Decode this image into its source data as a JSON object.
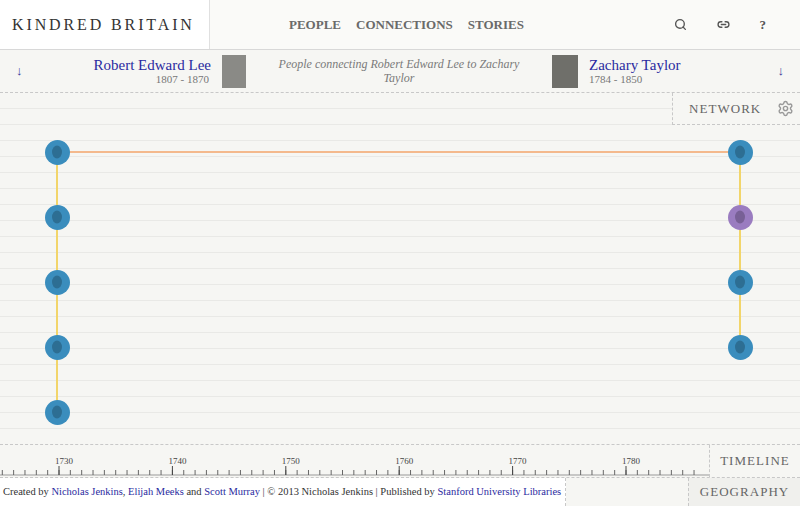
{
  "header": {
    "logo": "KINDRED BRITAIN",
    "nav": [
      "PEOPLE",
      "CONNECTIONS",
      "STORIES"
    ],
    "help": "?"
  },
  "connection": {
    "left": {
      "name": "Robert Edward Lee",
      "dates": "1807 - 1870",
      "arrow": "↓"
    },
    "right": {
      "name": "Zachary Taylor",
      "dates": "1784 - 1850",
      "arrow": "↓"
    },
    "caption": "People connecting Robert Edward Lee to Zachary Taylor"
  },
  "network": {
    "tab": "NETWORK",
    "left_chain": [
      {
        "color": "#3a8dbd"
      },
      {
        "color": "#3a8dbd"
      },
      {
        "color": "#3a8dbd"
      },
      {
        "color": "#3a8dbd"
      },
      {
        "color": "#3a8dbd"
      }
    ],
    "right_chain": [
      {
        "color": "#3a8dbd"
      },
      {
        "color": "#9a7cc0"
      },
      {
        "color": "#3a8dbd"
      },
      {
        "color": "#3a8dbd"
      }
    ]
  },
  "timeline": {
    "tab": "TIMELINE",
    "ticks": [
      "1730",
      "1740",
      "1750",
      "1760",
      "1770",
      "1780"
    ]
  },
  "footer": {
    "parts": [
      {
        "text": "Created by ",
        "link": false
      },
      {
        "text": "Nicholas Jenkins",
        "link": true
      },
      {
        "text": ", ",
        "link": false
      },
      {
        "text": "Elijah Meeks",
        "link": true
      },
      {
        "text": " and ",
        "link": false
      },
      {
        "text": "Scott Murray",
        "link": true
      },
      {
        "text": " | © 2013 Nicholas Jenkins | Published by ",
        "link": false
      },
      {
        "text": "Stanford University Libraries",
        "link": true
      }
    ],
    "tab": "GEOGRAPHY"
  }
}
